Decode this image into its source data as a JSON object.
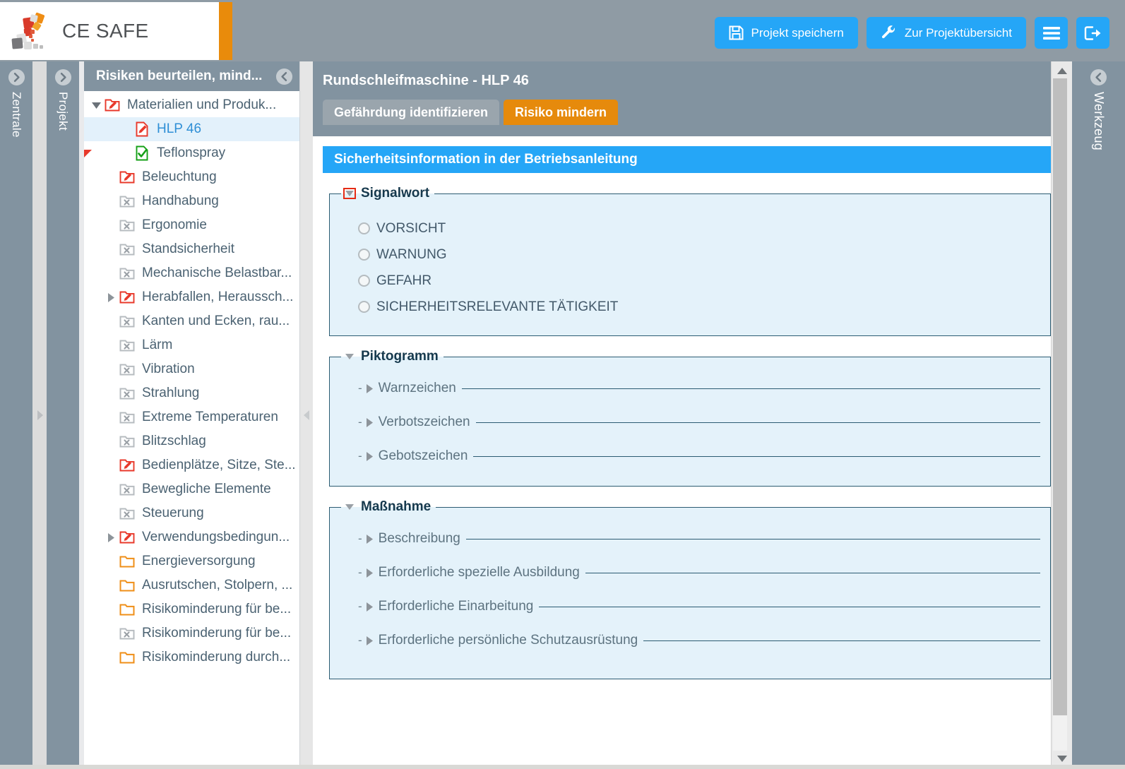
{
  "header": {
    "brand": "CE SAFE",
    "brand_icon": "ce-safe-logo",
    "accent_orange": "#e98b0b",
    "accent_blue": "#25a6f7",
    "bar_gray": "#8f9ba4",
    "buttons": [
      {
        "id": "save-project",
        "label": "Projekt speichern",
        "icon": "floppy-disk-icon"
      },
      {
        "id": "project-overview",
        "label": "Zur Projektübersicht",
        "icon": "wrench-icon"
      },
      {
        "id": "menu",
        "label": "",
        "icon": "hamburger-menu-icon"
      },
      {
        "id": "logout",
        "label": "",
        "icon": "logout-icon"
      }
    ]
  },
  "left_tabs": [
    {
      "id": "zentrale",
      "label": "Zentrale",
      "icon": "chevron-right-circle-icon"
    },
    {
      "id": "projekt",
      "label": "Projekt",
      "icon": "chevron-right-circle-icon"
    }
  ],
  "right_tab": {
    "id": "werkzeug",
    "label": "Werkzeug",
    "icon": "chevron-left-circle-icon"
  },
  "tree": {
    "title": "Risiken beurteilen, mind...",
    "collapse_icon": "chevron-left-circle-icon",
    "items": [
      {
        "label": "Materialien und Produk...",
        "icon": "folder-edit-red-icon",
        "indent": 0,
        "twist": "down",
        "selected": false,
        "flag": false
      },
      {
        "label": "HLP 46",
        "icon": "file-edit-red-icon",
        "indent": 1,
        "twist": "none",
        "selected": true,
        "flag": false
      },
      {
        "label": "Teflonspray",
        "icon": "file-check-green-icon",
        "indent": 1,
        "twist": "none",
        "selected": false,
        "flag": true
      },
      {
        "label": "Beleuchtung",
        "icon": "folder-edit-red-icon",
        "indent": 0.5,
        "twist": "none",
        "selected": false,
        "flag": false
      },
      {
        "label": "Handhabung",
        "icon": "folder-x-gray-icon",
        "indent": 0.5,
        "twist": "none",
        "selected": false,
        "flag": false
      },
      {
        "label": "Ergonomie",
        "icon": "folder-x-gray-icon",
        "indent": 0.5,
        "twist": "none",
        "selected": false,
        "flag": false
      },
      {
        "label": "Standsicherheit",
        "icon": "folder-x-gray-icon",
        "indent": 0.5,
        "twist": "none",
        "selected": false,
        "flag": false
      },
      {
        "label": "Mechanische Belastbar...",
        "icon": "folder-x-gray-icon",
        "indent": 0.5,
        "twist": "none",
        "selected": false,
        "flag": false
      },
      {
        "label": "Herabfallen, Heraussch...",
        "icon": "folder-edit-red-icon",
        "indent": 0.5,
        "twist": "right",
        "selected": false,
        "flag": false
      },
      {
        "label": "Kanten und Ecken, rau...",
        "icon": "folder-x-gray-icon",
        "indent": 0.5,
        "twist": "none",
        "selected": false,
        "flag": false
      },
      {
        "label": "Lärm",
        "icon": "folder-x-gray-icon",
        "indent": 0.5,
        "twist": "none",
        "selected": false,
        "flag": false
      },
      {
        "label": "Vibration",
        "icon": "folder-x-gray-icon",
        "indent": 0.5,
        "twist": "none",
        "selected": false,
        "flag": false
      },
      {
        "label": "Strahlung",
        "icon": "folder-x-gray-icon",
        "indent": 0.5,
        "twist": "none",
        "selected": false,
        "flag": false
      },
      {
        "label": "Extreme Temperaturen",
        "icon": "folder-x-gray-icon",
        "indent": 0.5,
        "twist": "none",
        "selected": false,
        "flag": false
      },
      {
        "label": "Blitzschlag",
        "icon": "folder-x-gray-icon",
        "indent": 0.5,
        "twist": "none",
        "selected": false,
        "flag": false
      },
      {
        "label": "Bedienplätze, Sitze, Ste...",
        "icon": "folder-edit-red-icon",
        "indent": 0.5,
        "twist": "none",
        "selected": false,
        "flag": false
      },
      {
        "label": "Bewegliche Elemente",
        "icon": "folder-x-gray-icon",
        "indent": 0.5,
        "twist": "none",
        "selected": false,
        "flag": false
      },
      {
        "label": "Steuerung",
        "icon": "folder-x-gray-icon",
        "indent": 0.5,
        "twist": "none",
        "selected": false,
        "flag": false
      },
      {
        "label": "Verwendungsbedingun...",
        "icon": "folder-edit-red-icon",
        "indent": 0.5,
        "twist": "right",
        "selected": false,
        "flag": false
      },
      {
        "label": "Energieversorgung",
        "icon": "folder-orange-icon",
        "indent": 0.5,
        "twist": "none",
        "selected": false,
        "flag": false
      },
      {
        "label": "Ausrutschen, Stolpern, ...",
        "icon": "folder-orange-icon",
        "indent": 0.5,
        "twist": "none",
        "selected": false,
        "flag": false
      },
      {
        "label": "Risikominderung für be...",
        "icon": "folder-orange-icon",
        "indent": 0.5,
        "twist": "none",
        "selected": false,
        "flag": false
      },
      {
        "label": "Risikominderung für be...",
        "icon": "folder-x-gray-icon",
        "indent": 0.5,
        "twist": "none",
        "selected": false,
        "flag": false
      },
      {
        "label": "Risikominderung durch...",
        "icon": "folder-orange-icon",
        "indent": 0.5,
        "twist": "none",
        "selected": false,
        "flag": false
      }
    ]
  },
  "main": {
    "title": "Rundschleifmaschine - HLP 46",
    "tabs": [
      {
        "id": "gefaehrdung",
        "label": "Gefährdung identifizieren",
        "active": false
      },
      {
        "id": "risiko",
        "label": "Risiko mindern",
        "active": true
      }
    ],
    "banner": "Sicherheitsinformation in der Betriebsanleitung",
    "sections": [
      {
        "id": "signalwort",
        "legend": "Signalwort",
        "toggle": "triangle-down-icon",
        "toggle_boxed": true,
        "options": [
          {
            "label": "VORSICHT",
            "checked": false
          },
          {
            "label": "WARNUNG",
            "checked": false
          },
          {
            "label": "GEFAHR",
            "checked": false
          },
          {
            "label": "SICHERHEITSRELEVANTE TÄTIGKEIT",
            "checked": false
          }
        ]
      },
      {
        "id": "piktogramm",
        "legend": "Piktogramm",
        "toggle": "triangle-down-icon",
        "toggle_boxed": false,
        "subrows": [
          {
            "label": "Warnzeichen",
            "toggle": "triangle-right-icon"
          },
          {
            "label": "Verbotszeichen",
            "toggle": "triangle-right-icon"
          },
          {
            "label": "Gebotszeichen",
            "toggle": "triangle-right-icon"
          }
        ]
      },
      {
        "id": "massnahme",
        "legend": "Maßnahme",
        "toggle": "triangle-down-icon",
        "toggle_boxed": false,
        "subrows": [
          {
            "label": "Beschreibung",
            "toggle": "triangle-right-icon"
          },
          {
            "label": "Erforderliche spezielle Ausbildung",
            "toggle": "triangle-right-icon"
          },
          {
            "label": "Erforderliche Einarbeitung",
            "toggle": "triangle-right-icon"
          },
          {
            "label": "Erforderliche persönliche Schutzausrüstung",
            "toggle": "triangle-right-icon"
          }
        ]
      }
    ]
  },
  "scrollbar": {
    "up_icon": "triangle-up-icon",
    "down_icon": "triangle-down-icon"
  }
}
